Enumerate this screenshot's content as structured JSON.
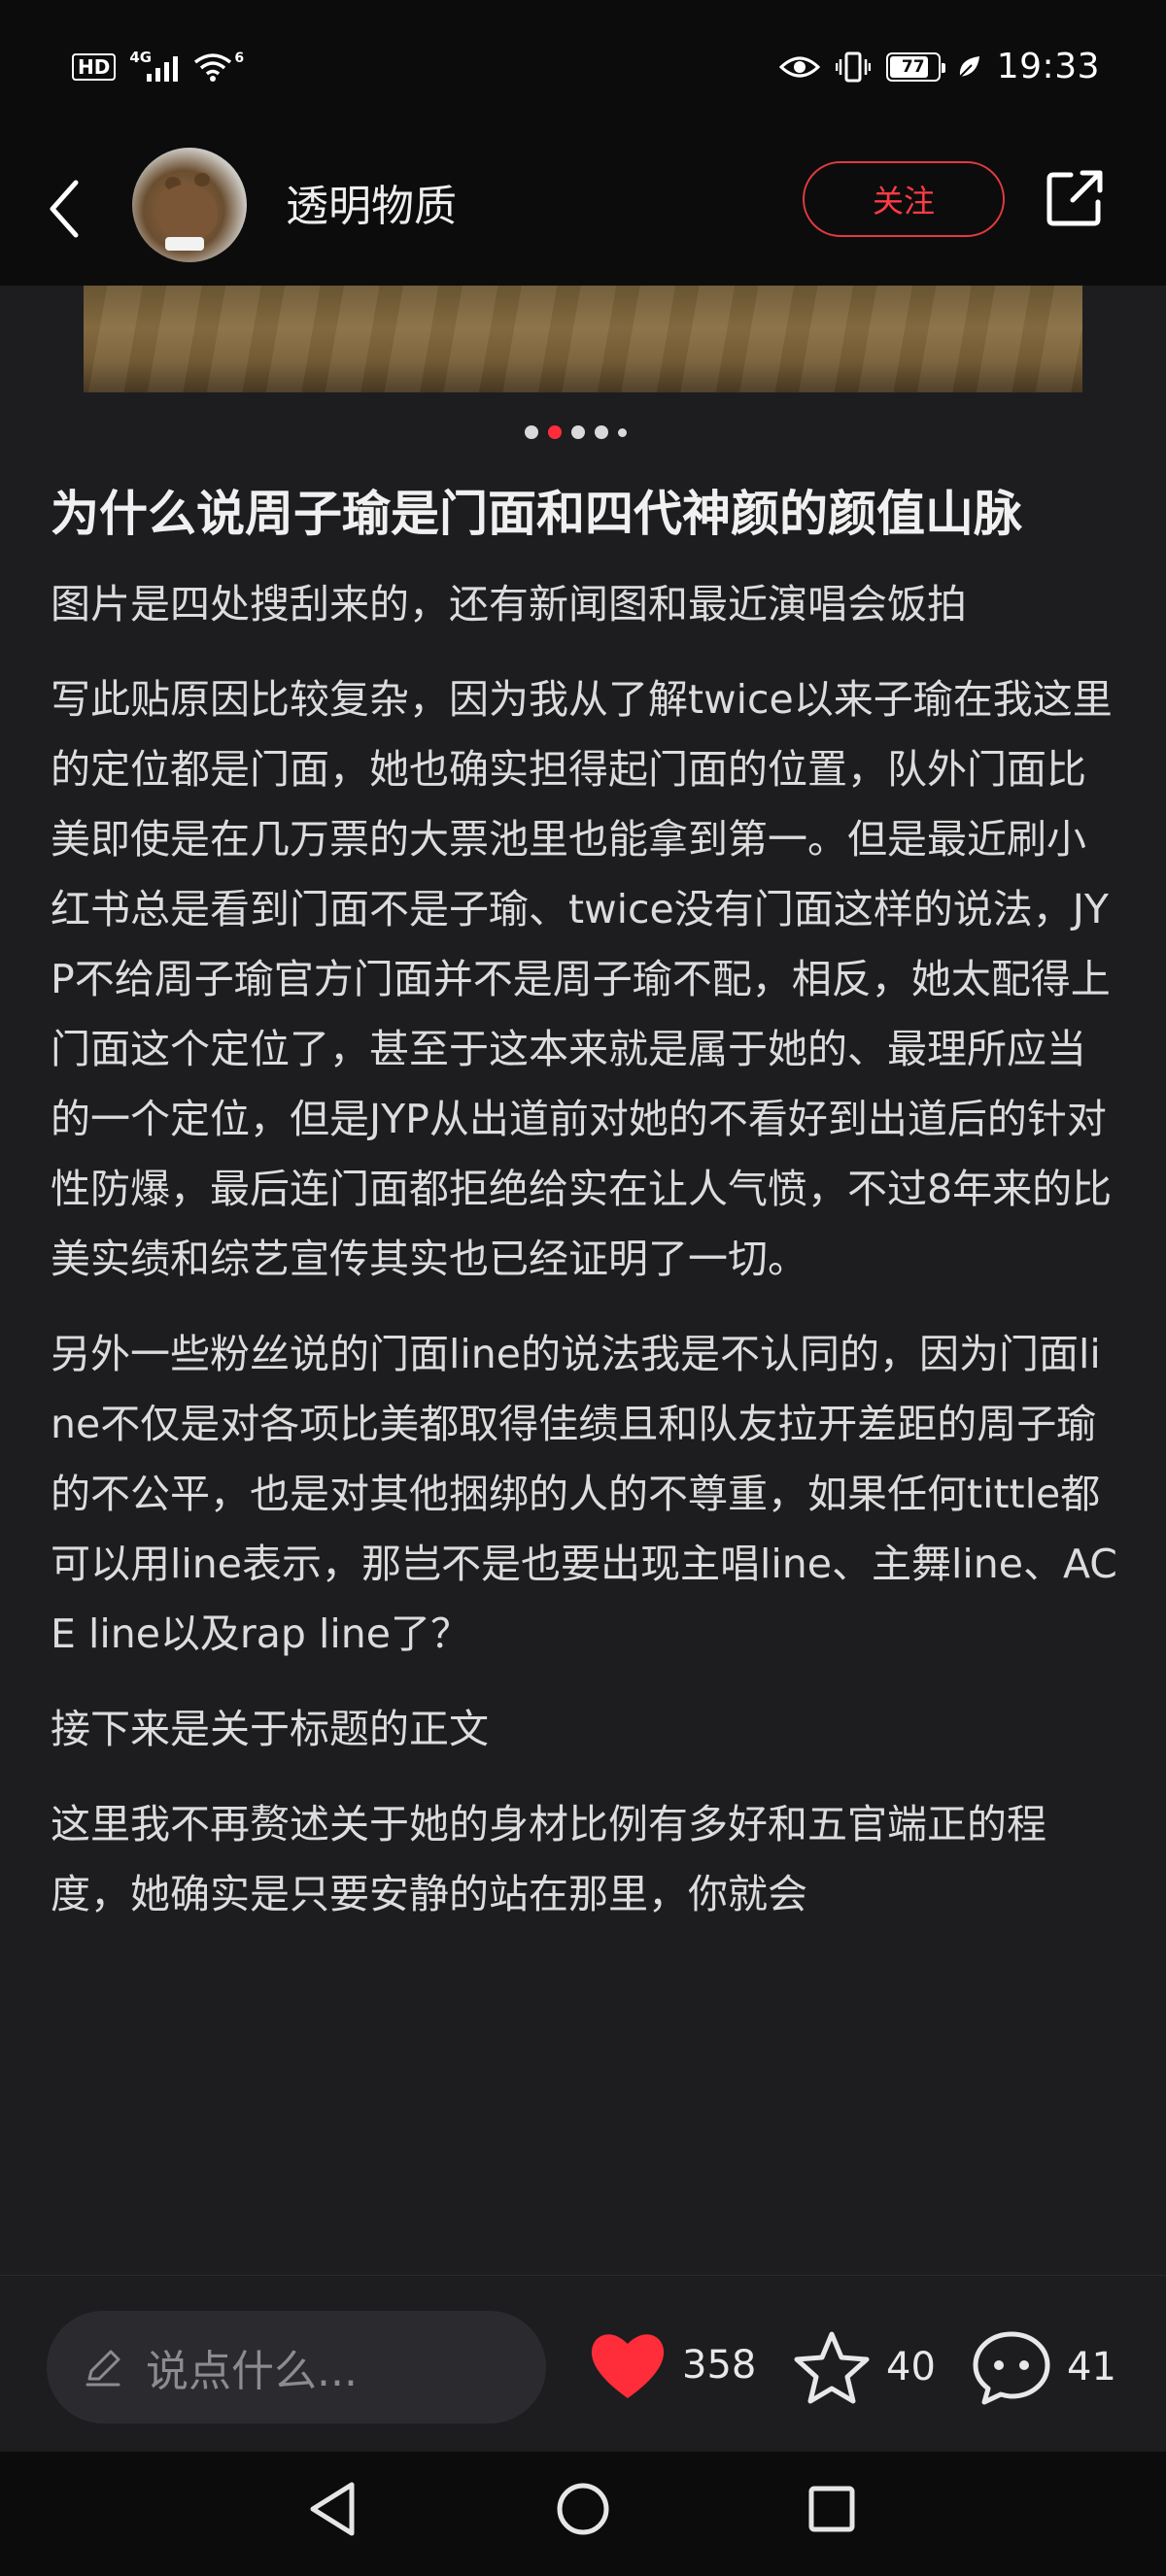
{
  "status_bar": {
    "hd_label": "HD",
    "net_label": "4G",
    "wifi_label": "6",
    "battery": "77",
    "time": "19:33"
  },
  "header": {
    "author": "透明物质",
    "follow_label": "关注"
  },
  "carousel": {
    "count": 5,
    "active_index": 1
  },
  "post": {
    "title": "为什么说周子瑜是门面和四代神颜的颜值山脉",
    "paragraphs": [
      "图片是四处搜刮来的，还有新闻图和最近演唱会饭拍",
      "写此贴原因比较复杂，因为我从了解twice以来子瑜在我这里的定位都是门面，她也确实担得起门面的位置，队外门面比美即使是在几万票的大票池里也能拿到第一。但是最近刷小红书总是看到门面不是子瑜、twice没有门面这样的说法，JYP不给周子瑜官方门面并不是周子瑜不配，相反，她太配得上门面这个定位了，甚至于这本来就是属于她的、最理所应当的一个定位，但是JYP从出道前对她的不看好到出道后的针对性防爆，最后连门面都拒绝给实在让人气愤，不过8年来的比美实绩和综艺宣传其实也已经证明了一切。",
      "另外一些粉丝说的门面line的说法我是不认同的，因为门面line不仅是对各项比美都取得佳绩且和队友拉开差距的周子瑜的不公平，也是对其他捆绑的人的不尊重，如果任何tittle都可以用line表示，那岂不是也要出现主唱line、主舞line、ACE line以及rap line了？",
      "接下来是关于标题的正文",
      "这里我不再赘述关于她的身材比例有多好和五官端正的程度，她确实是只要安静的站在那里，你就会"
    ]
  },
  "actions": {
    "comment_placeholder": "说点什么...",
    "likes": "358",
    "collects": "40",
    "comments": "41"
  },
  "colors": {
    "accent": "#ff2d3a",
    "background": "#1d1d20",
    "bar": "#0c0c0d"
  }
}
